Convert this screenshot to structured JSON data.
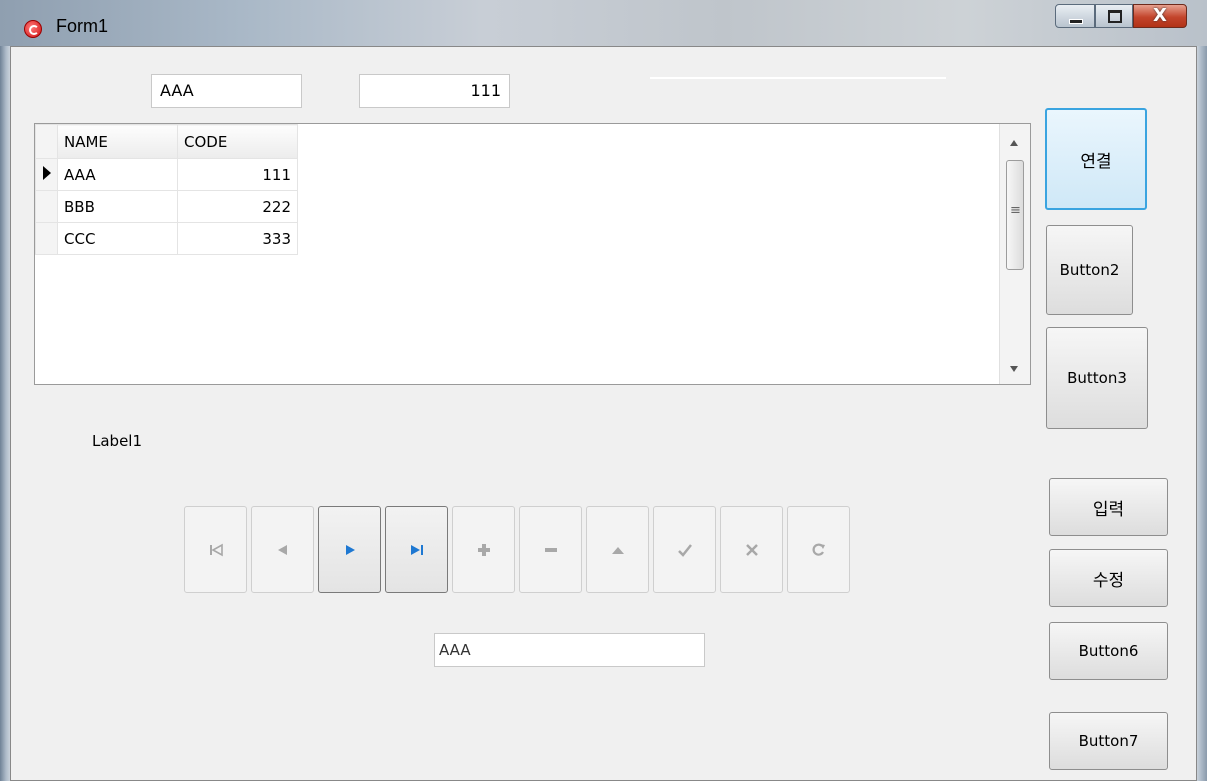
{
  "window": {
    "title": "Form1",
    "close_glyph": "X"
  },
  "top_fields": {
    "name_value": "AAA",
    "code_value": "111"
  },
  "grid": {
    "columns": [
      "NAME",
      "CODE"
    ],
    "rows": [
      {
        "name": "AAA",
        "code": "111"
      },
      {
        "name": "BBB",
        "code": "222"
      },
      {
        "name": "CCC",
        "code": "333"
      }
    ]
  },
  "buttons": {
    "connect": "연결",
    "button2": "Button2",
    "button3": "Button3",
    "insert": "입력",
    "edit": "수정",
    "button6": "Button6",
    "button7": "Button7"
  },
  "label1": "Label1",
  "navigator": {
    "buttons": [
      "first",
      "prior",
      "next",
      "last",
      "insert",
      "delete",
      "edit",
      "post",
      "cancel",
      "refresh"
    ],
    "active_color": "#1e78d2",
    "inactive_color": "#a8a8a8"
  },
  "bottom_field": {
    "value": "AAA"
  }
}
